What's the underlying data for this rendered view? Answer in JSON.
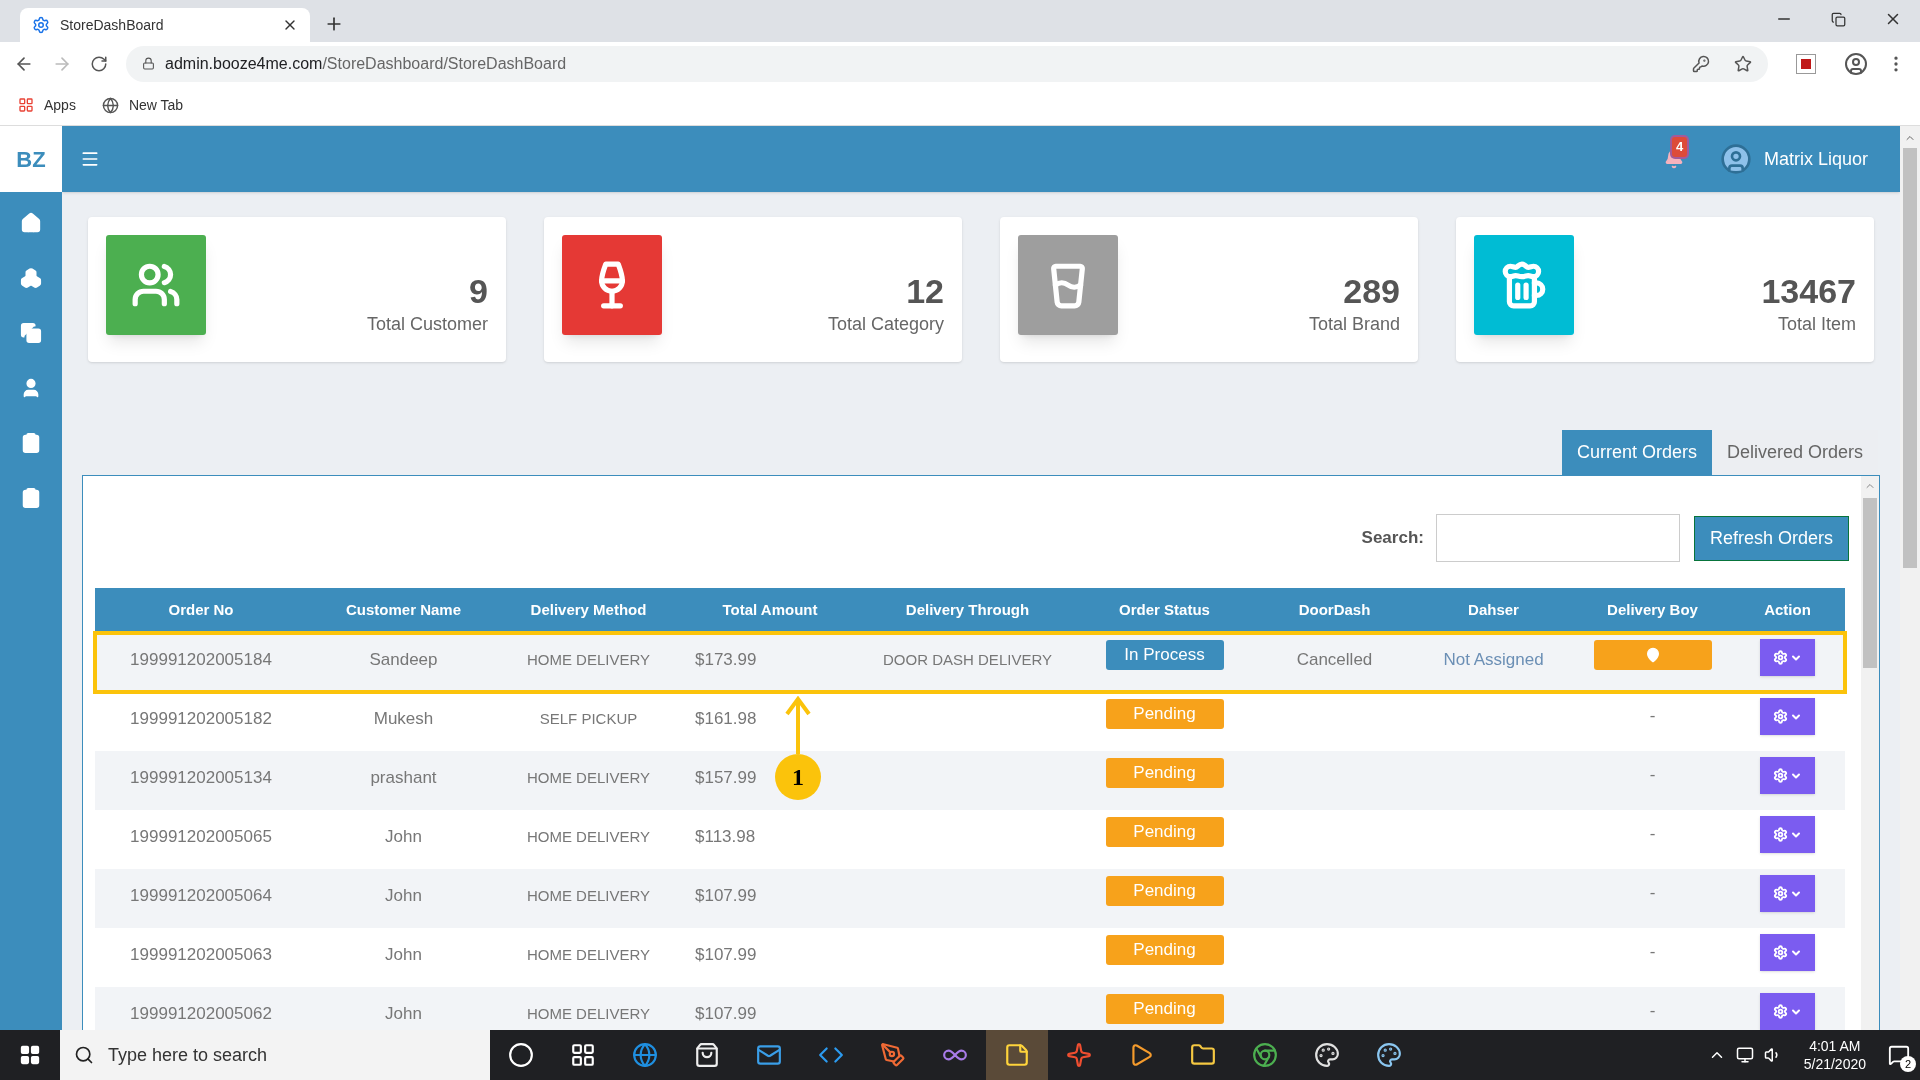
{
  "browser": {
    "tab_title": "StoreDashBoard",
    "url_host": "admin.booze4me.com",
    "url_path": "/StoreDashboard/StoreDashBoard",
    "bookmarks": [
      "Apps",
      "New Tab"
    ]
  },
  "app": {
    "logo": "BZ",
    "notification_count": "4",
    "user_name": "Matrix Liquor"
  },
  "stats": [
    {
      "kind": "customers",
      "value": "9",
      "label": "Total Customer",
      "color": "#4caf50"
    },
    {
      "kind": "category",
      "value": "12",
      "label": "Total Category",
      "color": "#e53935"
    },
    {
      "kind": "brand",
      "value": "289",
      "label": "Total Brand",
      "color": "#9e9e9e"
    },
    {
      "kind": "item",
      "value": "13467",
      "label": "Total Item",
      "color": "#00bcd4"
    }
  ],
  "tabs": [
    {
      "label": "Current Orders",
      "selected": true
    },
    {
      "label": "Delivered Orders",
      "selected": false
    }
  ],
  "search": {
    "label": "Search:"
  },
  "refresh_button": "Refresh Orders",
  "table": {
    "columns": [
      "Order No",
      "Customer Name",
      "Delivery Method",
      "Total Amount",
      "Delivery Through",
      "Order Status",
      "DoorDash",
      "Dahser",
      "Delivery Boy",
      "Action"
    ],
    "rows": [
      {
        "order_no": "199991202005184",
        "customer": "Sandeep",
        "method": "HOME DELIVERY",
        "amount": "$173.99",
        "through": "DOOR DASH DELIVERY",
        "status": {
          "label": "In Process",
          "kind": "in_process"
        },
        "doordash": "Cancelled",
        "dasher": "Not Assigned",
        "delivery_boy": {
          "kind": "location_button"
        },
        "highlighted": true
      },
      {
        "order_no": "199991202005182",
        "customer": "Mukesh",
        "method": "SELF PICKUP",
        "amount": "$161.98",
        "status": {
          "label": "Pending",
          "kind": "pending"
        },
        "delivery_boy": {
          "kind": "text",
          "text": "-"
        },
        "highlighted": false
      },
      {
        "order_no": "199991202005134",
        "customer": "prashant",
        "method": "HOME DELIVERY",
        "amount": "$157.99",
        "status": {
          "label": "Pending",
          "kind": "pending"
        },
        "delivery_boy": {
          "kind": "text",
          "text": "-"
        },
        "highlighted": false
      },
      {
        "order_no": "199991202005065",
        "customer": "John",
        "method": "HOME DELIVERY",
        "amount": "$113.98",
        "status": {
          "label": "Pending",
          "kind": "pending"
        },
        "delivery_boy": {
          "kind": "text",
          "text": "-"
        },
        "highlighted": false
      },
      {
        "order_no": "199991202005064",
        "customer": "John",
        "method": "HOME DELIVERY",
        "amount": "$107.99",
        "status": {
          "label": "Pending",
          "kind": "pending"
        },
        "delivery_boy": {
          "kind": "text",
          "text": "-"
        },
        "highlighted": false
      },
      {
        "order_no": "199991202005063",
        "customer": "John",
        "method": "HOME DELIVERY",
        "amount": "$107.99",
        "status": {
          "label": "Pending",
          "kind": "pending"
        },
        "delivery_boy": {
          "kind": "text",
          "text": "-"
        },
        "highlighted": false
      },
      {
        "order_no": "199991202005062",
        "customer": "John",
        "method": "HOME DELIVERY",
        "amount": "$107.99",
        "status": {
          "label": "Pending",
          "kind": "pending"
        },
        "delivery_boy": {
          "kind": "text",
          "text": "-"
        },
        "highlighted": false
      }
    ]
  },
  "annotation": {
    "label": "1"
  },
  "taskbar": {
    "search_placeholder": "Type here to search",
    "time": "4:01 AM",
    "date": "5/21/2020",
    "notification_count": "2"
  }
}
